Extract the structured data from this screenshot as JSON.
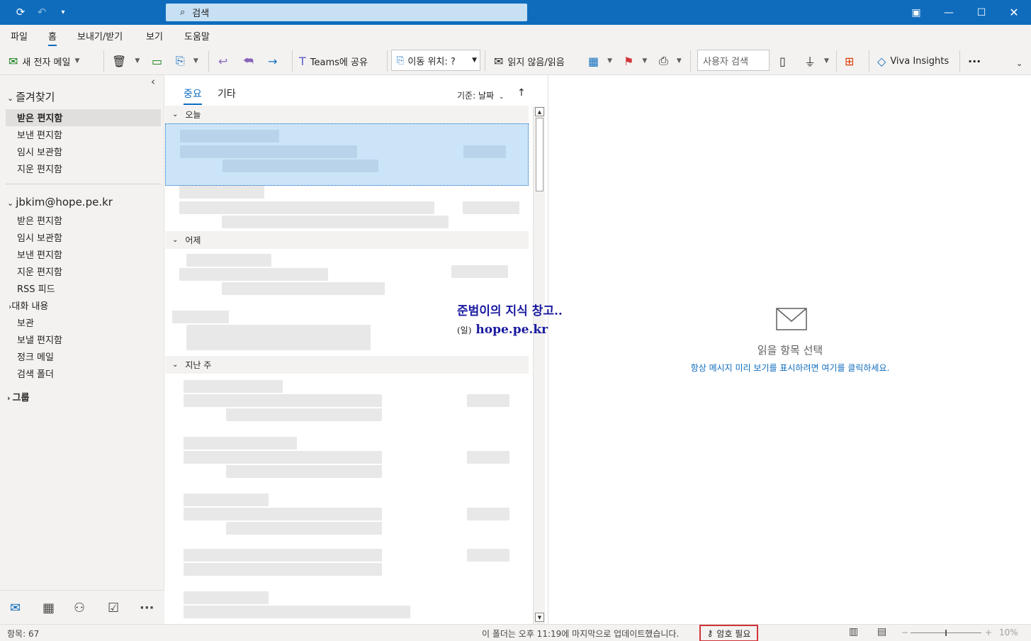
{
  "titlebar": {
    "search_placeholder": "검색"
  },
  "menu": {
    "items": [
      "파일",
      "홈",
      "보내기/받기",
      "보기",
      "도움말"
    ],
    "active_index": 1
  },
  "ribbon": {
    "new_mail": "새 전자 메일",
    "teams_share": "Teams에 공유",
    "move_to": "이동 위치: ?",
    "read_unread": "읽지 않음/읽음",
    "people_search_placeholder": "사용자 검색",
    "viva": "Viva Insights",
    "more": "···"
  },
  "folders": {
    "favorites_header": "즐겨찾기",
    "favorites": [
      "받은 편지함",
      "보낸 편지함",
      "임시 보관함",
      "지운 편지함"
    ],
    "account_header": "jbkim@hope.pe.kr",
    "account_folders": [
      "받은 편지함",
      "임시 보관함",
      "보낸 편지함",
      "지운 편지함",
      "RSS 피드"
    ],
    "conversation": "대화 내용",
    "account_folders_2": [
      "보관",
      "보낼 편지함",
      "정크 메일",
      "검색 폴더"
    ],
    "groups_header": "그룹",
    "collapse": "‹"
  },
  "message_list": {
    "tab_focused": "중요",
    "tab_other": "기타",
    "sort": "기준: 날짜",
    "groups": [
      "오늘",
      "어제",
      "지난 주"
    ]
  },
  "reading_pane": {
    "title": "읽을 항목 선택",
    "link": "항상 메시지 미리 보기를 표시하려면 여기를 클릭하세요."
  },
  "watermark": {
    "line1": "준범이의 지식 창고..",
    "line2_prefix": "(일)",
    "line2": "hope.pe.kr"
  },
  "status": {
    "items": "항목: 67",
    "updated": "이 폴더는 오후 11:19에 마지막으로 업데이트했습니다.",
    "password": "암호 필요",
    "zoom": "10%"
  },
  "colors": {
    "accent": "#0f6cbd",
    "flag": "#d13438",
    "watermark": "#1a1aa0"
  }
}
